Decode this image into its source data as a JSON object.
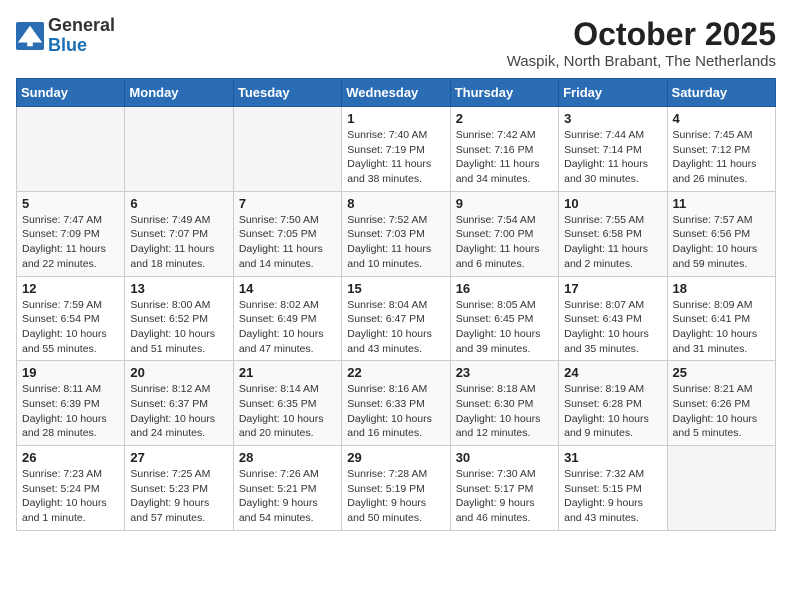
{
  "logo": {
    "general": "General",
    "blue": "Blue"
  },
  "title": "October 2025",
  "subtitle": "Waspik, North Brabant, The Netherlands",
  "weekdays": [
    "Sunday",
    "Monday",
    "Tuesday",
    "Wednesday",
    "Thursday",
    "Friday",
    "Saturday"
  ],
  "weeks": [
    [
      {
        "day": "",
        "info": ""
      },
      {
        "day": "",
        "info": ""
      },
      {
        "day": "",
        "info": ""
      },
      {
        "day": "1",
        "info": "Sunrise: 7:40 AM\nSunset: 7:19 PM\nDaylight: 11 hours\nand 38 minutes."
      },
      {
        "day": "2",
        "info": "Sunrise: 7:42 AM\nSunset: 7:16 PM\nDaylight: 11 hours\nand 34 minutes."
      },
      {
        "day": "3",
        "info": "Sunrise: 7:44 AM\nSunset: 7:14 PM\nDaylight: 11 hours\nand 30 minutes."
      },
      {
        "day": "4",
        "info": "Sunrise: 7:45 AM\nSunset: 7:12 PM\nDaylight: 11 hours\nand 26 minutes."
      }
    ],
    [
      {
        "day": "5",
        "info": "Sunrise: 7:47 AM\nSunset: 7:09 PM\nDaylight: 11 hours\nand 22 minutes."
      },
      {
        "day": "6",
        "info": "Sunrise: 7:49 AM\nSunset: 7:07 PM\nDaylight: 11 hours\nand 18 minutes."
      },
      {
        "day": "7",
        "info": "Sunrise: 7:50 AM\nSunset: 7:05 PM\nDaylight: 11 hours\nand 14 minutes."
      },
      {
        "day": "8",
        "info": "Sunrise: 7:52 AM\nSunset: 7:03 PM\nDaylight: 11 hours\nand 10 minutes."
      },
      {
        "day": "9",
        "info": "Sunrise: 7:54 AM\nSunset: 7:00 PM\nDaylight: 11 hours\nand 6 minutes."
      },
      {
        "day": "10",
        "info": "Sunrise: 7:55 AM\nSunset: 6:58 PM\nDaylight: 11 hours\nand 2 minutes."
      },
      {
        "day": "11",
        "info": "Sunrise: 7:57 AM\nSunset: 6:56 PM\nDaylight: 10 hours\nand 59 minutes."
      }
    ],
    [
      {
        "day": "12",
        "info": "Sunrise: 7:59 AM\nSunset: 6:54 PM\nDaylight: 10 hours\nand 55 minutes."
      },
      {
        "day": "13",
        "info": "Sunrise: 8:00 AM\nSunset: 6:52 PM\nDaylight: 10 hours\nand 51 minutes."
      },
      {
        "day": "14",
        "info": "Sunrise: 8:02 AM\nSunset: 6:49 PM\nDaylight: 10 hours\nand 47 minutes."
      },
      {
        "day": "15",
        "info": "Sunrise: 8:04 AM\nSunset: 6:47 PM\nDaylight: 10 hours\nand 43 minutes."
      },
      {
        "day": "16",
        "info": "Sunrise: 8:05 AM\nSunset: 6:45 PM\nDaylight: 10 hours\nand 39 minutes."
      },
      {
        "day": "17",
        "info": "Sunrise: 8:07 AM\nSunset: 6:43 PM\nDaylight: 10 hours\nand 35 minutes."
      },
      {
        "day": "18",
        "info": "Sunrise: 8:09 AM\nSunset: 6:41 PM\nDaylight: 10 hours\nand 31 minutes."
      }
    ],
    [
      {
        "day": "19",
        "info": "Sunrise: 8:11 AM\nSunset: 6:39 PM\nDaylight: 10 hours\nand 28 minutes."
      },
      {
        "day": "20",
        "info": "Sunrise: 8:12 AM\nSunset: 6:37 PM\nDaylight: 10 hours\nand 24 minutes."
      },
      {
        "day": "21",
        "info": "Sunrise: 8:14 AM\nSunset: 6:35 PM\nDaylight: 10 hours\nand 20 minutes."
      },
      {
        "day": "22",
        "info": "Sunrise: 8:16 AM\nSunset: 6:33 PM\nDaylight: 10 hours\nand 16 minutes."
      },
      {
        "day": "23",
        "info": "Sunrise: 8:18 AM\nSunset: 6:30 PM\nDaylight: 10 hours\nand 12 minutes."
      },
      {
        "day": "24",
        "info": "Sunrise: 8:19 AM\nSunset: 6:28 PM\nDaylight: 10 hours\nand 9 minutes."
      },
      {
        "day": "25",
        "info": "Sunrise: 8:21 AM\nSunset: 6:26 PM\nDaylight: 10 hours\nand 5 minutes."
      }
    ],
    [
      {
        "day": "26",
        "info": "Sunrise: 7:23 AM\nSunset: 5:24 PM\nDaylight: 10 hours\nand 1 minute."
      },
      {
        "day": "27",
        "info": "Sunrise: 7:25 AM\nSunset: 5:23 PM\nDaylight: 9 hours\nand 57 minutes."
      },
      {
        "day": "28",
        "info": "Sunrise: 7:26 AM\nSunset: 5:21 PM\nDaylight: 9 hours\nand 54 minutes."
      },
      {
        "day": "29",
        "info": "Sunrise: 7:28 AM\nSunset: 5:19 PM\nDaylight: 9 hours\nand 50 minutes."
      },
      {
        "day": "30",
        "info": "Sunrise: 7:30 AM\nSunset: 5:17 PM\nDaylight: 9 hours\nand 46 minutes."
      },
      {
        "day": "31",
        "info": "Sunrise: 7:32 AM\nSunset: 5:15 PM\nDaylight: 9 hours\nand 43 minutes."
      },
      {
        "day": "",
        "info": ""
      }
    ]
  ]
}
